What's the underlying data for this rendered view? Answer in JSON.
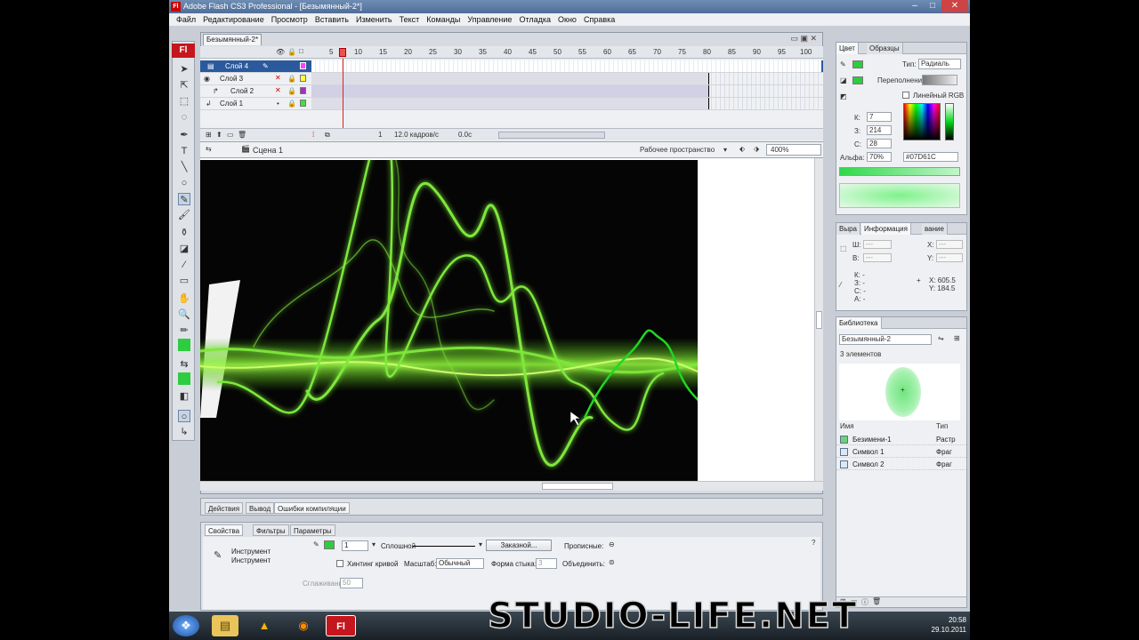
{
  "window": {
    "title": "Adobe Flash CS3 Professional - [Безымянный-2*]",
    "app_badge": "Fl"
  },
  "menu": [
    "Файл",
    "Редактирование",
    "Просмотр",
    "Вставить",
    "Изменить",
    "Текст",
    "Команды",
    "Управление",
    "Отладка",
    "Окно",
    "Справка"
  ],
  "document": {
    "tab": "Безымянный-2*"
  },
  "timeline": {
    "ruler": [
      "5",
      "10",
      "15",
      "20",
      "25",
      "30",
      "35",
      "40",
      "45",
      "50",
      "55",
      "60",
      "65",
      "70",
      "75",
      "80",
      "85",
      "90",
      "95",
      "100"
    ],
    "layers": [
      {
        "name": "Слой 4",
        "selected": true
      },
      {
        "name": "Слой 3",
        "selected": false
      },
      {
        "name": "Слой 2",
        "selected": false
      },
      {
        "name": "Слой 1",
        "selected": false
      }
    ],
    "footer": {
      "frame": "1",
      "fps": "12.0 кадров/с",
      "time": "0.0с"
    }
  },
  "editbar": {
    "scene": "Сцена 1",
    "workspace": "Рабочее пространство",
    "zoom": "400%"
  },
  "bottom_tabs": [
    "Действия",
    "Вывод",
    "Ошибки компиляции"
  ],
  "props": {
    "tabs": [
      "Свойства",
      "Фильтры",
      "Параметры"
    ],
    "tool_line1": "Инструмент",
    "tool_line2": "Инструмент",
    "stroke_size": "1",
    "stroke_style": "Сплошной",
    "custom_button": "Заказной...",
    "caps_label": "Прописные:",
    "hinting_label": "Хинтинг кривой",
    "scale_label": "Масштаб:",
    "scale_value": "Обычный",
    "join_label": "Форма стыка:",
    "join_value": "3",
    "merge_label": "Объединить:",
    "smoothing_label": "Сглаживание",
    "smoothing_value": "50"
  },
  "color_panel": {
    "tabs": [
      "Цвет",
      "Образцы"
    ],
    "type_label": "Тип:",
    "type_value": "Радиаль",
    "overflow_label": "Переполнение:",
    "linear_rgb": "Линейный RGB",
    "r_label": "К:",
    "r_value": "7",
    "g_label": "З:",
    "g_value": "214",
    "b_label": "С:",
    "b_value": "28",
    "alpha_label": "Альфа:",
    "alpha_value": "70%",
    "hex": "#07D61C"
  },
  "info_panel": {
    "tabs": [
      "Выра",
      "Информация",
      "вание"
    ],
    "w_label": "Ш:",
    "w_value": "---",
    "h_label": "В:",
    "h_value": "---",
    "x_label": "Х:",
    "x_value": "---",
    "y_label": "Y:",
    "y_value": "---",
    "r": "К: -",
    "g": "З: -",
    "b": "С: -",
    "a": "А: -",
    "cx": "X:  605.5",
    "cy": "Y:  184.5"
  },
  "library": {
    "tab": "Библиотека",
    "doc": "Безымянный-2",
    "count": "3 элементов",
    "col_name": "Имя",
    "col_type": "Тип",
    "items": [
      {
        "name": "Безимени-1",
        "type": "Растр"
      },
      {
        "name": "Символ 1",
        "type": "Фраг"
      },
      {
        "name": "Символ 2",
        "type": "Фраг"
      }
    ]
  },
  "taskbar": {
    "time": "20:58",
    "date": "29.10.2011",
    "flash_badge": "Fl"
  },
  "watermark": "STUDIO-LIFE.NET",
  "colors": {
    "accent_green": "#07D61C",
    "stage_bg": "#050505",
    "flash_red": "#c4161c"
  }
}
